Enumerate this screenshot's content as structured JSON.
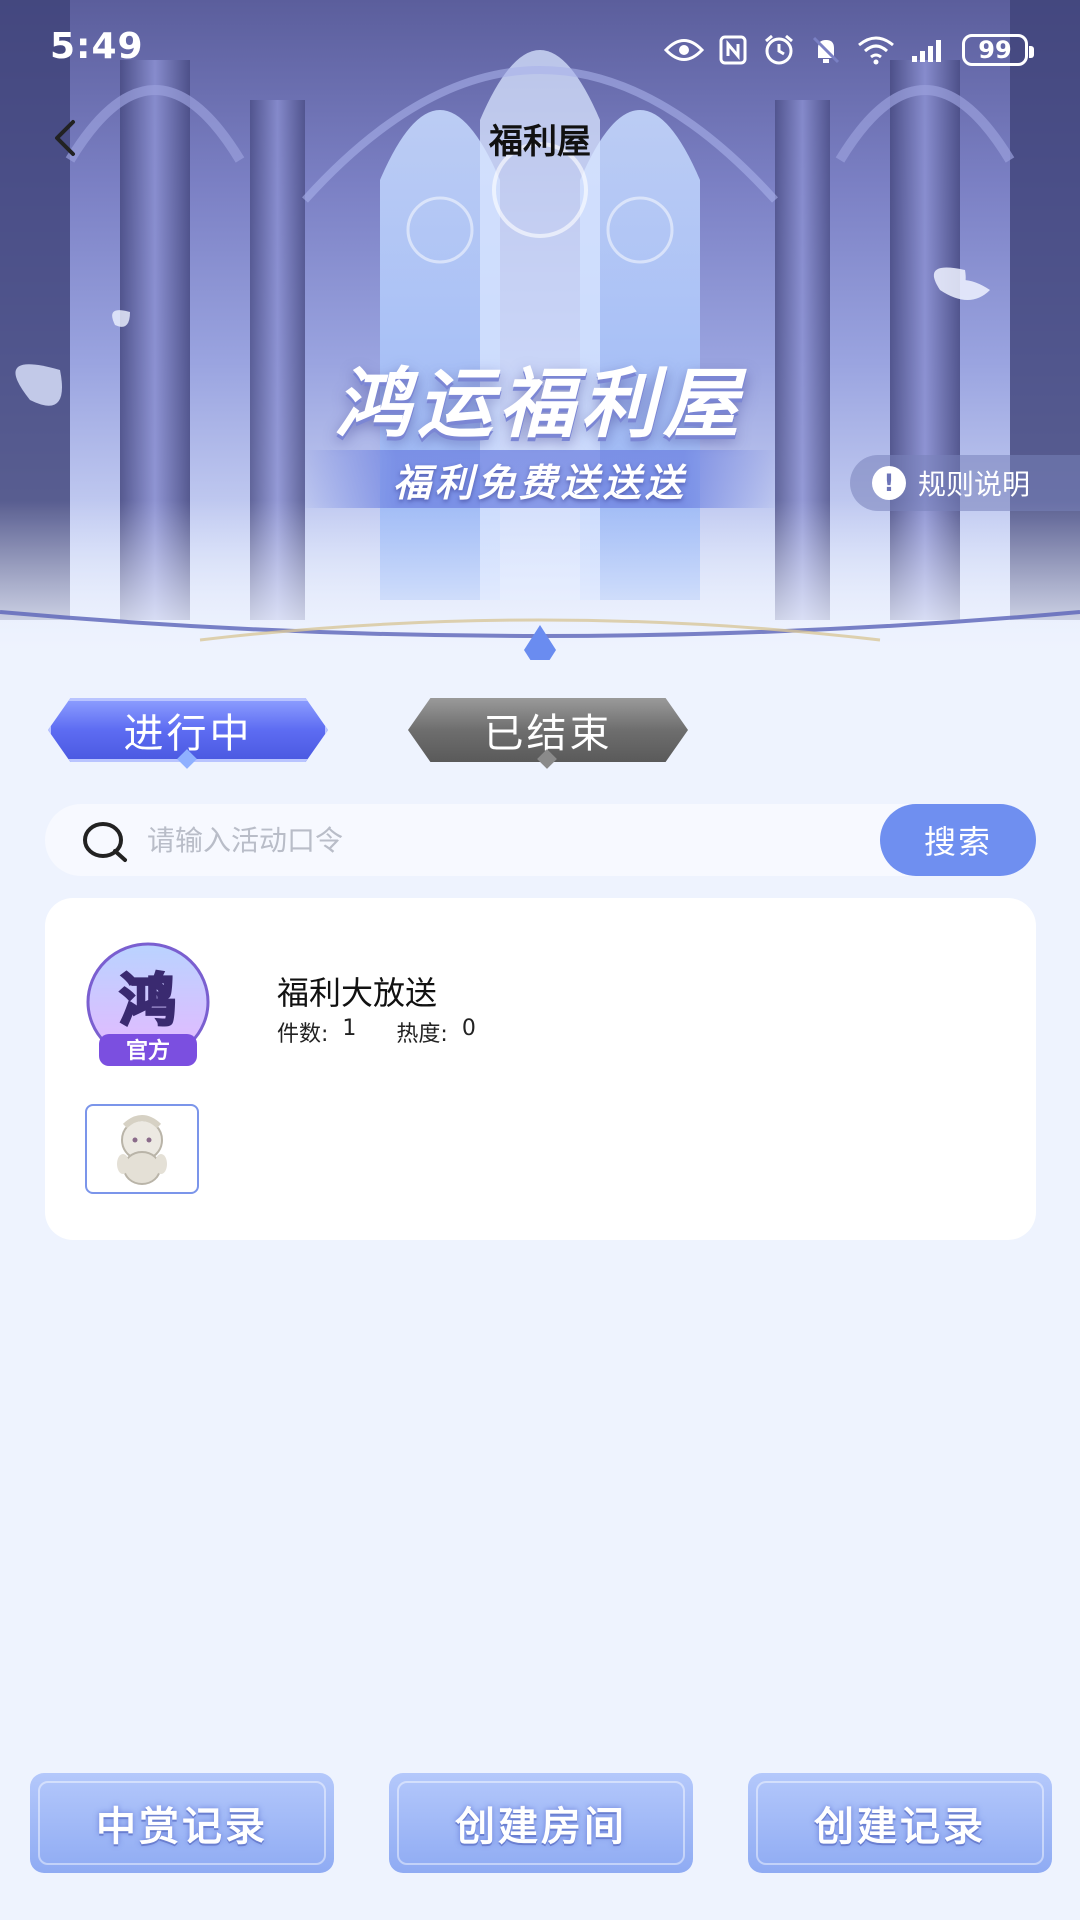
{
  "status_bar": {
    "time": "5:49",
    "battery": "99",
    "icons": [
      "eye-icon",
      "nfc-icon",
      "alarm-icon",
      "mute-icon",
      "wifi-icon",
      "signal-icon"
    ]
  },
  "header": {
    "title": "福利屋",
    "back_icon": "chevron-left-icon"
  },
  "banner": {
    "title": "鸿运福利屋",
    "subtitle": "福利免费送送送",
    "rules_label": "规则说明"
  },
  "tabs": [
    {
      "label": "进行中",
      "active": true
    },
    {
      "label": "已结束",
      "active": false
    }
  ],
  "search": {
    "placeholder": "请输入活动口令",
    "value": "",
    "button_label": "搜索"
  },
  "activities": [
    {
      "avatar_text": "鸿",
      "avatar_badge": "官方",
      "title": "福利大放送",
      "count_label": "件数:",
      "count": "1",
      "heat_label": "热度:",
      "heat": "0"
    }
  ],
  "bottom_buttons": [
    {
      "label": "中赏记录"
    },
    {
      "label": "创建房间"
    },
    {
      "label": "创建记录"
    }
  ],
  "colors": {
    "accent": "#6f8ff0",
    "background": "#eef3fe",
    "tab_active": "#5d6cf2",
    "tab_inactive": "#6e6e6e"
  }
}
